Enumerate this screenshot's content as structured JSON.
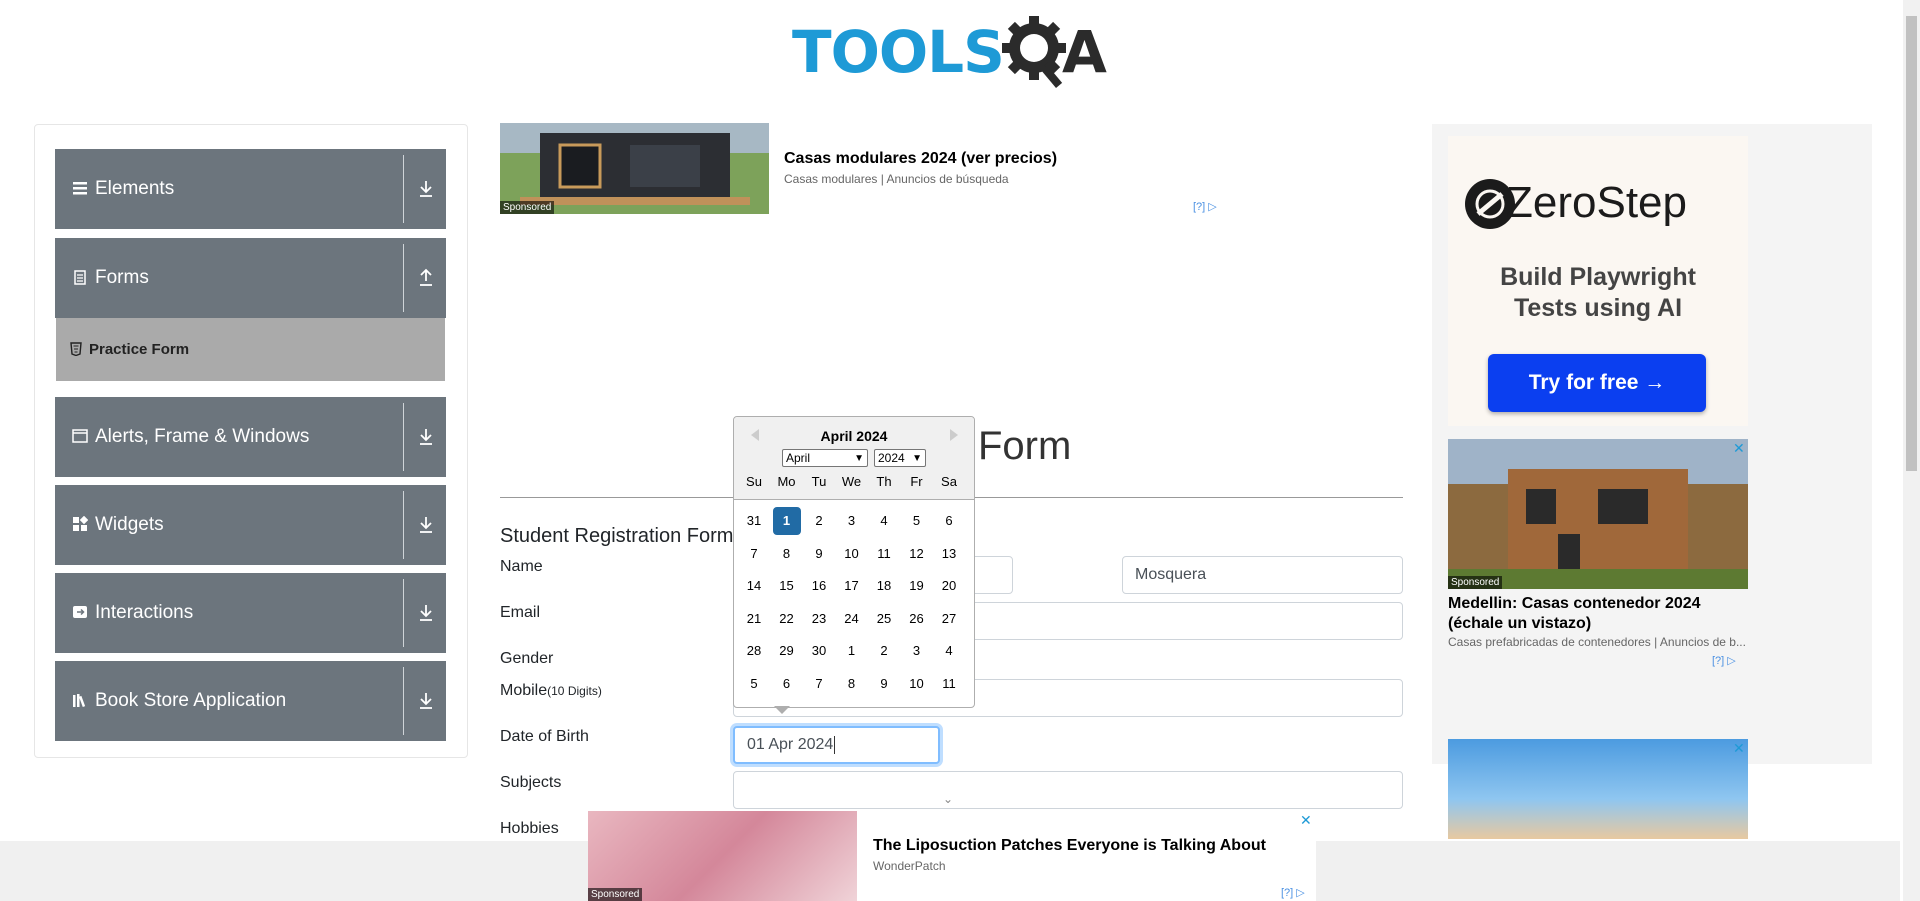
{
  "logo": {
    "text_left": "TOOLS",
    "text_right": "A",
    "alt": "ToolsQA"
  },
  "sidebar": {
    "groups": [
      {
        "label": "Elements",
        "icon": "hamburger-icon",
        "arrow": "download-icon"
      },
      {
        "label": "Forms",
        "icon": "document-icon",
        "arrow": "upload-icon"
      },
      {
        "label": "Alerts, Frame & Windows",
        "icon": "window-icon",
        "arrow": "download-icon"
      },
      {
        "label": "Widgets",
        "icon": "grid-icon",
        "arrow": "download-icon"
      },
      {
        "label": "Interactions",
        "icon": "interaction-icon",
        "arrow": "download-icon"
      },
      {
        "label": "Book Store Application",
        "icon": "books-icon",
        "arrow": "download-icon"
      }
    ],
    "active_item": {
      "label": "Practice Form",
      "icon": "html5-icon"
    }
  },
  "top_ad": {
    "title": "Casas modulares 2024 (ver precios)",
    "subtitle": "Casas modulares | Anuncios de búsqueda",
    "sponsored": "Sponsored",
    "choices": "[?]"
  },
  "main": {
    "heading": "Form",
    "form_title": "Student Registration Form",
    "labels": {
      "name": "Name",
      "email": "Email",
      "gender": "Gender",
      "mobile": "Mobile",
      "mobile_hint": "(10 Digits)",
      "dob": "Date of Birth",
      "subjects": "Subjects",
      "hobbies": "Hobbies"
    },
    "values": {
      "last_name": "Mosquera",
      "dob": "01 Apr 2024"
    }
  },
  "datepicker": {
    "title": "April 2024",
    "month_select": "April",
    "year_select": "2024",
    "weekdays": [
      "Su",
      "Mo",
      "Tu",
      "We",
      "Th",
      "Fr",
      "Sa"
    ],
    "weeks": [
      [
        "31",
        "1",
        "2",
        "3",
        "4",
        "5",
        "6"
      ],
      [
        "7",
        "8",
        "9",
        "10",
        "11",
        "12",
        "13"
      ],
      [
        "14",
        "15",
        "16",
        "17",
        "18",
        "19",
        "20"
      ],
      [
        "21",
        "22",
        "23",
        "24",
        "25",
        "26",
        "27"
      ],
      [
        "28",
        "29",
        "30",
        "1",
        "2",
        "3",
        "4"
      ],
      [
        "5",
        "6",
        "7",
        "8",
        "9",
        "10",
        "11"
      ]
    ],
    "selected_day": "1"
  },
  "right_ad": {
    "brand": "ZeroStep",
    "tagline_line1": "Build Playwright",
    "tagline_line2": "Tests using AI",
    "cta": "Try for free →",
    "ad2_title": "Medellin: Casas contenedor 2024 (échale un vistazo)",
    "ad2_sub": "Casas prefabricadas de contenedores | Anuncios de b...",
    "sponsored": "Sponsored",
    "choices": "[?]",
    "close": "✕"
  },
  "bottom_ad": {
    "title": "The Liposuction Patches Everyone is Talking About",
    "subtitle": "WonderPatch",
    "sponsored": "Sponsored",
    "choices": "[?]",
    "close": "✕"
  },
  "colors": {
    "accent_blue": "#1e9ad6",
    "sidebar_gray": "#6c757d",
    "selected_day": "#216ba5",
    "cta_blue": "#0b3ff0"
  }
}
